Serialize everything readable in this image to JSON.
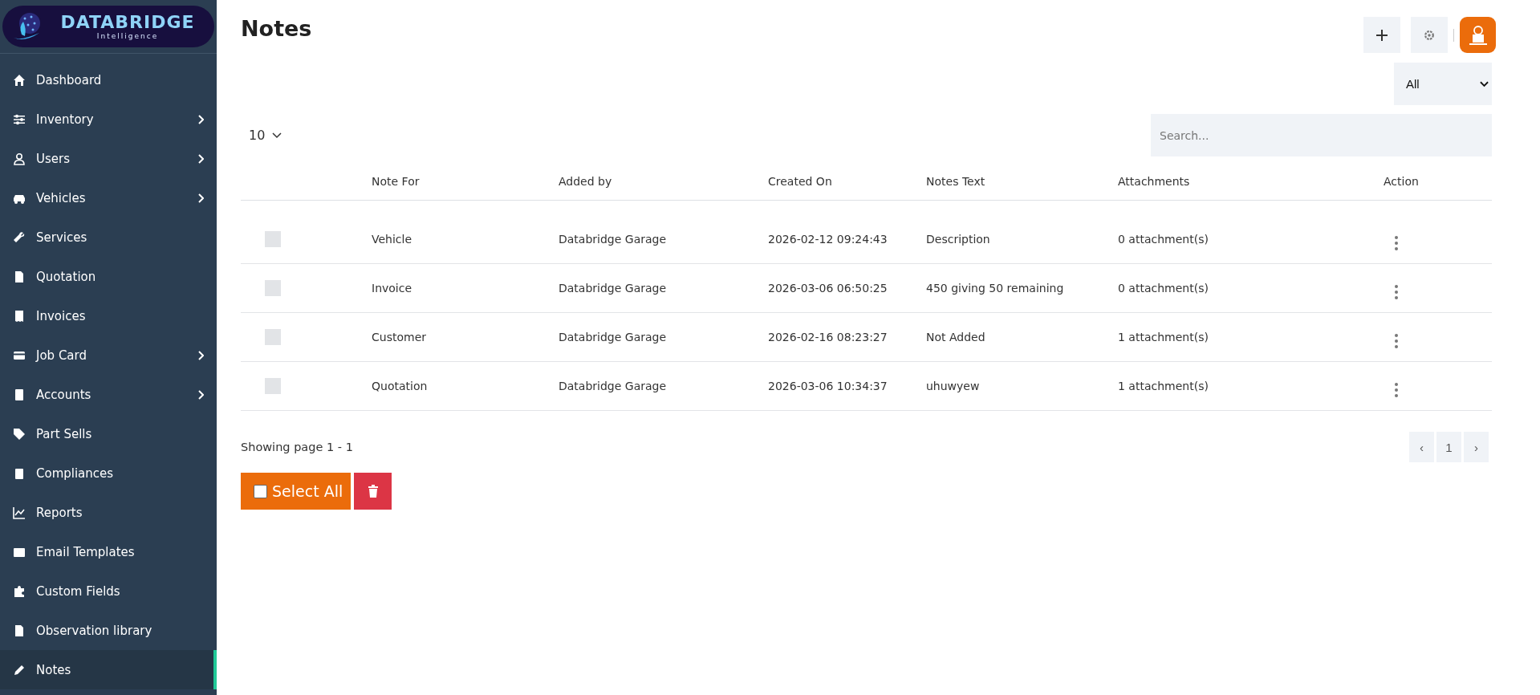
{
  "logo": {
    "title": "DATABRIDGE",
    "subtitle": "Intelligence"
  },
  "sidebar": {
    "items": [
      {
        "label": "Dashboard",
        "submenu": false,
        "selected": false
      },
      {
        "label": "Inventory",
        "submenu": true,
        "selected": false
      },
      {
        "label": "Users",
        "submenu": true,
        "selected": false
      },
      {
        "label": "Vehicles",
        "submenu": true,
        "selected": false
      },
      {
        "label": "Services",
        "submenu": false,
        "selected": false
      },
      {
        "label": "Quotation",
        "submenu": false,
        "selected": false
      },
      {
        "label": "Invoices",
        "submenu": false,
        "selected": false
      },
      {
        "label": "Job Card",
        "submenu": true,
        "selected": false
      },
      {
        "label": "Accounts",
        "submenu": true,
        "selected": false
      },
      {
        "label": "Part Sells",
        "submenu": false,
        "selected": false
      },
      {
        "label": "Compliances",
        "submenu": false,
        "selected": false
      },
      {
        "label": "Reports",
        "submenu": false,
        "selected": false
      },
      {
        "label": "Email Templates",
        "submenu": false,
        "selected": false
      },
      {
        "label": "Custom Fields",
        "submenu": false,
        "selected": false
      },
      {
        "label": "Observation library",
        "submenu": false,
        "selected": false
      },
      {
        "label": "Notes",
        "submenu": false,
        "selected": true
      }
    ]
  },
  "page": {
    "title": "Notes"
  },
  "filter": {
    "value": "All"
  },
  "per_page": {
    "value": "10"
  },
  "search": {
    "placeholder": "Search..."
  },
  "table": {
    "columns": [
      "Note For",
      "Added by",
      "Created On",
      "Notes Text",
      "Attachments",
      "Action"
    ],
    "rows": [
      {
        "checked": false,
        "cells": [
          "Vehicle",
          "Databridge Garage",
          "2026-02-12 09:24:43",
          "Description",
          "0 attachment(s)"
        ]
      },
      {
        "checked": false,
        "cells": [
          "Invoice",
          "Databridge Garage",
          "2026-03-06 06:50:25",
          "450 giving 50 remaining",
          "0 attachment(s)"
        ]
      },
      {
        "checked": false,
        "cells": [
          "Customer",
          "Databridge Garage",
          "2026-02-16 08:23:27",
          "Not Added",
          "1 attachment(s)"
        ]
      },
      {
        "checked": false,
        "cells": [
          "Quotation",
          "Databridge Garage",
          "2026-03-06 10:34:37",
          "uhuwyew",
          "1 attachment(s)"
        ]
      }
    ]
  },
  "pagination": {
    "summary": "Showing page 1 - 1",
    "prev": "‹",
    "page": "1",
    "next": "›"
  },
  "bulk": {
    "select_all": {
      "label": "Select All",
      "checked": false
    }
  }
}
